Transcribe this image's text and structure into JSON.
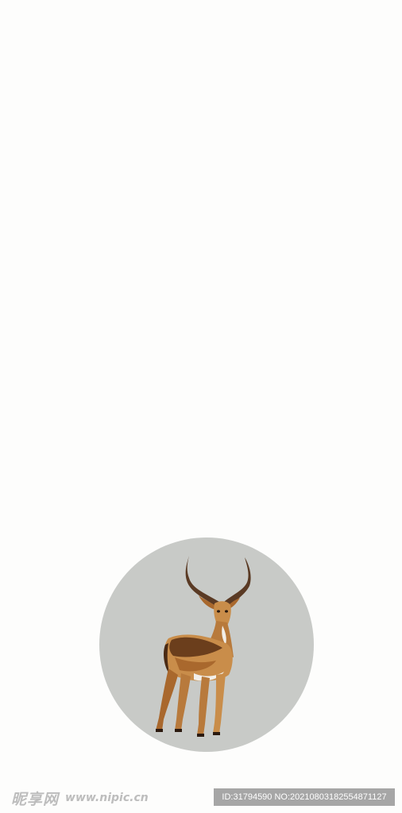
{
  "image": {
    "subject": "antelope-in-circle",
    "colors": {
      "background": "#fdfdfc",
      "circle": "#c8cac7",
      "fur_light": "#c98d4a",
      "fur_mid": "#a9682d",
      "fur_dark": "#6b3e1c",
      "horn": "#5a3a24",
      "belly": "#f2efe9"
    }
  },
  "watermark": {
    "site_logo": "昵享网",
    "site_url": "www.nipic.cn",
    "id_text": "ID:31794590 NO:20210803182554871127"
  }
}
